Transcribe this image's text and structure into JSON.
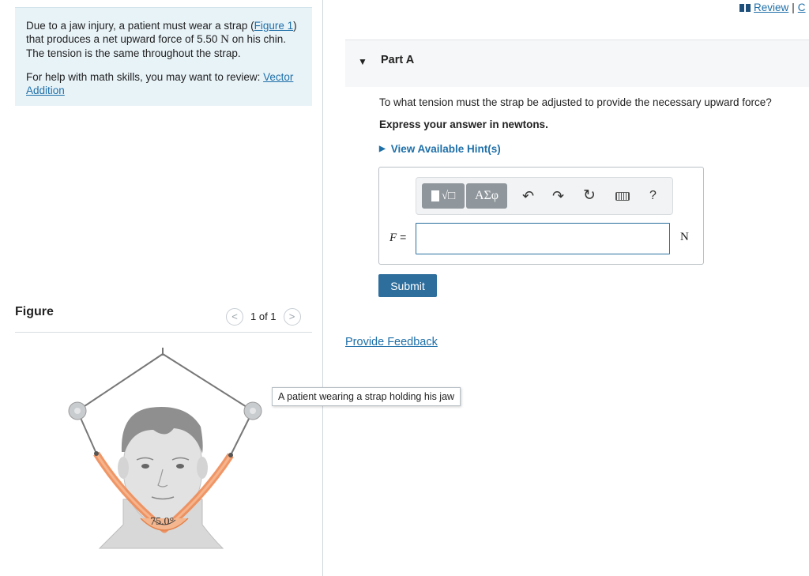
{
  "problem": {
    "text_before_link": "Due to a jaw injury, a patient must wear a strap (",
    "figure_link": "Figure 1",
    "text_mid": ") that produces a net upward force of 5.50 ",
    "force_unit": "N",
    "text_after": " on his chin. The tension is the same throughout the strap.",
    "help_prefix": "For help with math skills, you may want to review: ",
    "help_link": "Vector Addition"
  },
  "figure": {
    "title": "Figure",
    "pager_text": "1 of 1",
    "prev_glyph": "<",
    "next_glyph": ">",
    "angle_label": "75.0°",
    "tooltip": "A patient wearing a strap holding his jaw"
  },
  "header": {
    "review_label": "Review",
    "separator": "|",
    "constants_label": "C"
  },
  "part": {
    "title": "Part A",
    "question": "To what tension must the strap be adjusted to provide the necessary upward force?",
    "express": "Express your answer in newtons.",
    "hints_label": "View Available Hint(s)"
  },
  "answer": {
    "variable": "F",
    "equals": "=",
    "value": "",
    "unit": "N",
    "toolbar": {
      "templates_glyph": "√□",
      "greek_glyph": "ΑΣφ",
      "undo_glyph": "↶",
      "redo_glyph": "↷",
      "reset_glyph": "↻",
      "help_glyph": "?"
    }
  },
  "submit_label": "Submit",
  "feedback_label": "Provide Feedback",
  "colors": {
    "link": "#1e6fa8",
    "submit_bg": "#2d6e9d",
    "problem_bg": "#e8f3f8",
    "strap": "#ee8b55"
  }
}
